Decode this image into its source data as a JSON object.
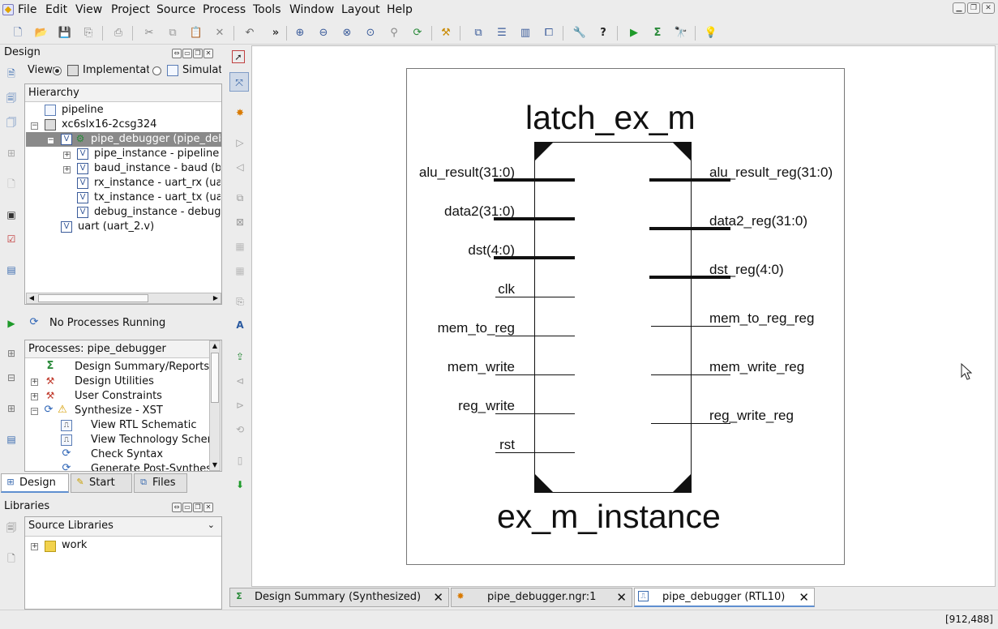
{
  "menu": [
    "File",
    "Edit",
    "View",
    "Project",
    "Source",
    "Process",
    "Tools",
    "Window",
    "Layout",
    "Help"
  ],
  "design_panel": {
    "title": "Design",
    "view_label": "View:",
    "radio_impl": "Implementation",
    "radio_sim": "Simulation",
    "hierarchy_label": "Hierarchy",
    "tree": [
      "pipeline",
      "xc6slx16-2csg324",
      "pipe_debugger (pipe_debugger.v)",
      "pipe_instance - pipeline (pipeline.v)",
      "baud_instance - baud (baud.v)",
      "rx_instance - uart_rx (uart_rx.v)",
      "tx_instance - uart_tx (uart_tx.v)",
      "debug_instance - debug_uart (debug_uart.v)",
      "uart (uart_2.v)"
    ],
    "process_status": "No Processes Running",
    "processes_label": "Processes: pipe_debugger",
    "processes": [
      "Design Summary/Reports",
      "Design Utilities",
      "User Constraints",
      "Synthesize - XST",
      "View RTL Schematic",
      "View Technology Schematic",
      "Check Syntax",
      "Generate Post-Synthesis Simulation Model"
    ],
    "tabs": [
      "Design",
      "Start",
      "Files"
    ]
  },
  "libraries_panel": {
    "title": "Libraries",
    "dropdown": "Source Libraries",
    "items": [
      "work"
    ]
  },
  "schematic": {
    "top_label": "latch_ex_m",
    "bottom_label": "ex_m_instance",
    "inputs": [
      "alu_result(31:0)",
      "data2(31:0)",
      "dst(4:0)",
      "clk",
      "mem_to_reg",
      "mem_write",
      "reg_write",
      "rst"
    ],
    "input_bus": [
      true,
      true,
      true,
      false,
      false,
      false,
      false,
      false
    ],
    "outputs": [
      "alu_result_reg(31:0)",
      "data2_reg(31:0)",
      "dst_reg(4:0)",
      "mem_to_reg_reg",
      "mem_write_reg",
      "reg_write_reg"
    ],
    "output_bus": [
      true,
      true,
      true,
      false,
      false,
      false
    ]
  },
  "editor_tabs": [
    {
      "label": "Design Summary (Synthesized)",
      "icon": "sigma-icon"
    },
    {
      "label": "pipe_debugger.ngr:1",
      "icon": "schematic-icon"
    },
    {
      "label": "pipe_debugger (RTL10)",
      "icon": "rtl-doc-icon"
    }
  ],
  "status": {
    "coords": "[912,488]"
  }
}
